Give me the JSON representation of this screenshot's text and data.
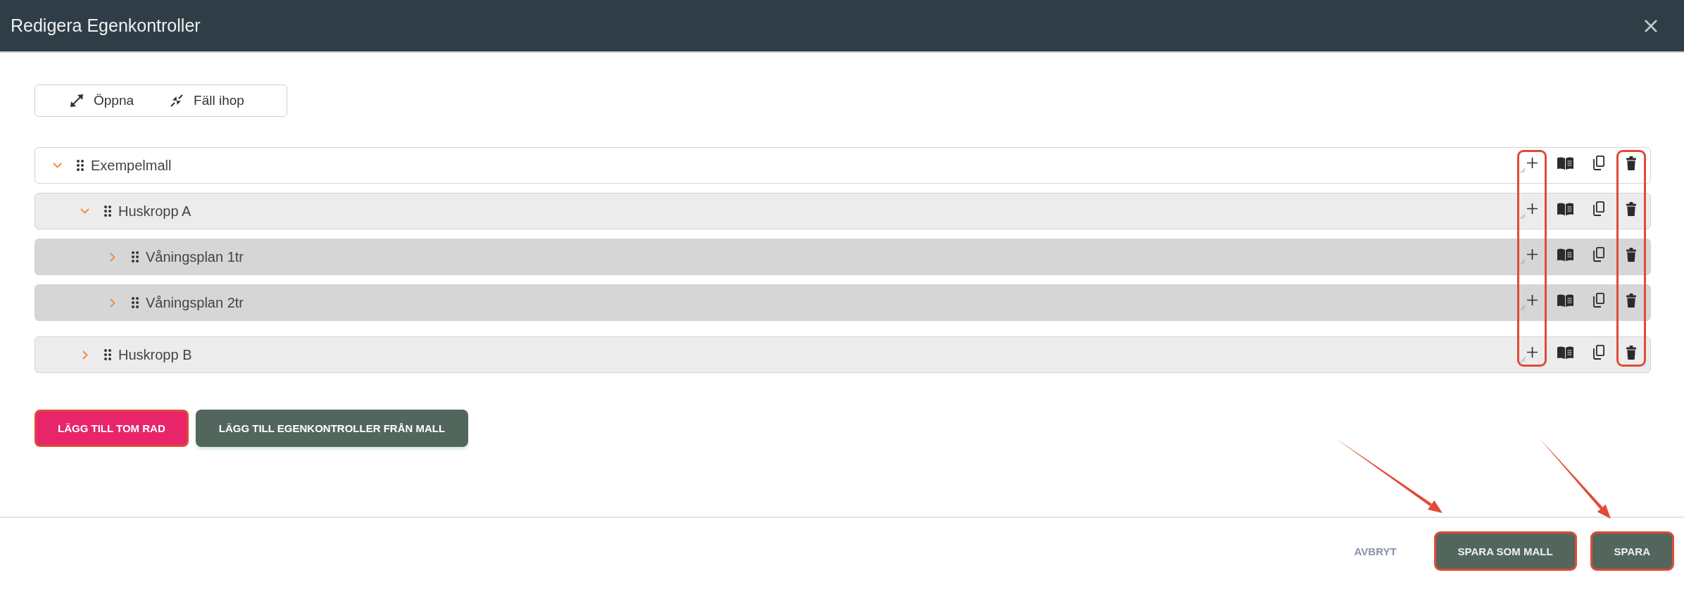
{
  "dialog": {
    "title": "Redigera Egenkontroller"
  },
  "toolbar": [
    {
      "kind": "expand",
      "label": "Öppna"
    },
    {
      "kind": "collapse",
      "label": "Fäll ihop"
    }
  ],
  "tree": {
    "row_actions": [
      {
        "kind": "add",
        "highlighted": true
      },
      {
        "kind": "template",
        "highlighted": false
      },
      {
        "kind": "copy",
        "highlighted": false
      },
      {
        "kind": "delete",
        "highlighted": true
      }
    ],
    "items": [
      {
        "label": "Exempelmall",
        "expanded": true,
        "children": [
          {
            "label": "Huskropp A",
            "expanded": true,
            "children": [
              {
                "label": "Våningsplan 1tr",
                "expanded": false
              },
              {
                "label": "Våningsplan 2tr",
                "expanded": false
              }
            ]
          },
          {
            "label": "Huskropp B",
            "expanded": false
          }
        ]
      }
    ]
  },
  "add_buttons": [
    {
      "kind": "accent",
      "label": "LÄGG TILL TOM RAD",
      "highlighted": true
    },
    {
      "kind": "secondary",
      "label": "LÄGG TILL EGENKONTROLLER FRÅN MALL",
      "highlighted": false
    }
  ],
  "annotations": [
    {
      "kind": "arrow"
    },
    {
      "kind": "arrow"
    }
  ],
  "footer": [
    {
      "kind": "text",
      "label": "AVBRYT",
      "highlighted": false
    },
    {
      "kind": "primary",
      "label": "SPARA SOM MALL",
      "highlighted": true
    },
    {
      "kind": "primary",
      "label": "SPARA",
      "highlighted": true
    }
  ]
}
